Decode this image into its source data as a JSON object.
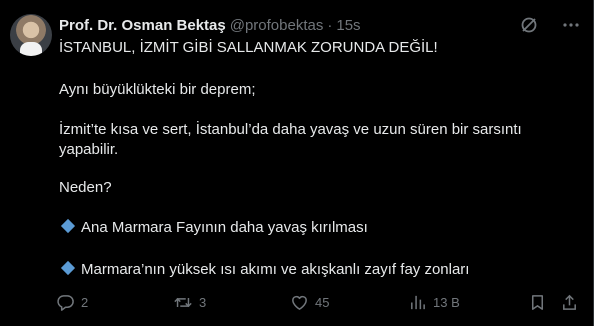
{
  "author": {
    "name": "Prof. Dr. Osman Bektaş",
    "handle": "@profobektas",
    "separator": "·",
    "time": "15s"
  },
  "tweet_lines": {
    "l1": "İSTANBUL, İZMİT GİBİ SALLANMAK ZORUNDA DEĞİL!",
    "l2": "Aynı büyüklükteki bir deprem;",
    "l3": "İzmit’te kısa ve sert, İstanbul’da daha yavaş ve uzun süren bir sarsıntı",
    "l4": "yapabilir.",
    "l5": "Neden?",
    "b1": "Ana Marmara Fayının daha yavaş kırılması",
    "b2": "Marmara’nın yüksek ısı akımı ve akışkanlı zayıf fay zonları"
  },
  "actions": {
    "reply_count": "2",
    "retweet_count": "3",
    "like_count": "45",
    "views_count": "13 B"
  },
  "icons": {
    "grok": "grok-icon",
    "more": "more-icon",
    "reply": "reply-icon",
    "retweet": "retweet-icon",
    "like": "like-icon",
    "views": "views-icon",
    "bookmark": "bookmark-icon",
    "share": "share-icon",
    "bullet": "blue-diamond-icon"
  },
  "colors": {
    "background": "#000000",
    "text": "#e7e9ea",
    "secondary": "#71767b",
    "bullet": "#5b9bd5"
  }
}
